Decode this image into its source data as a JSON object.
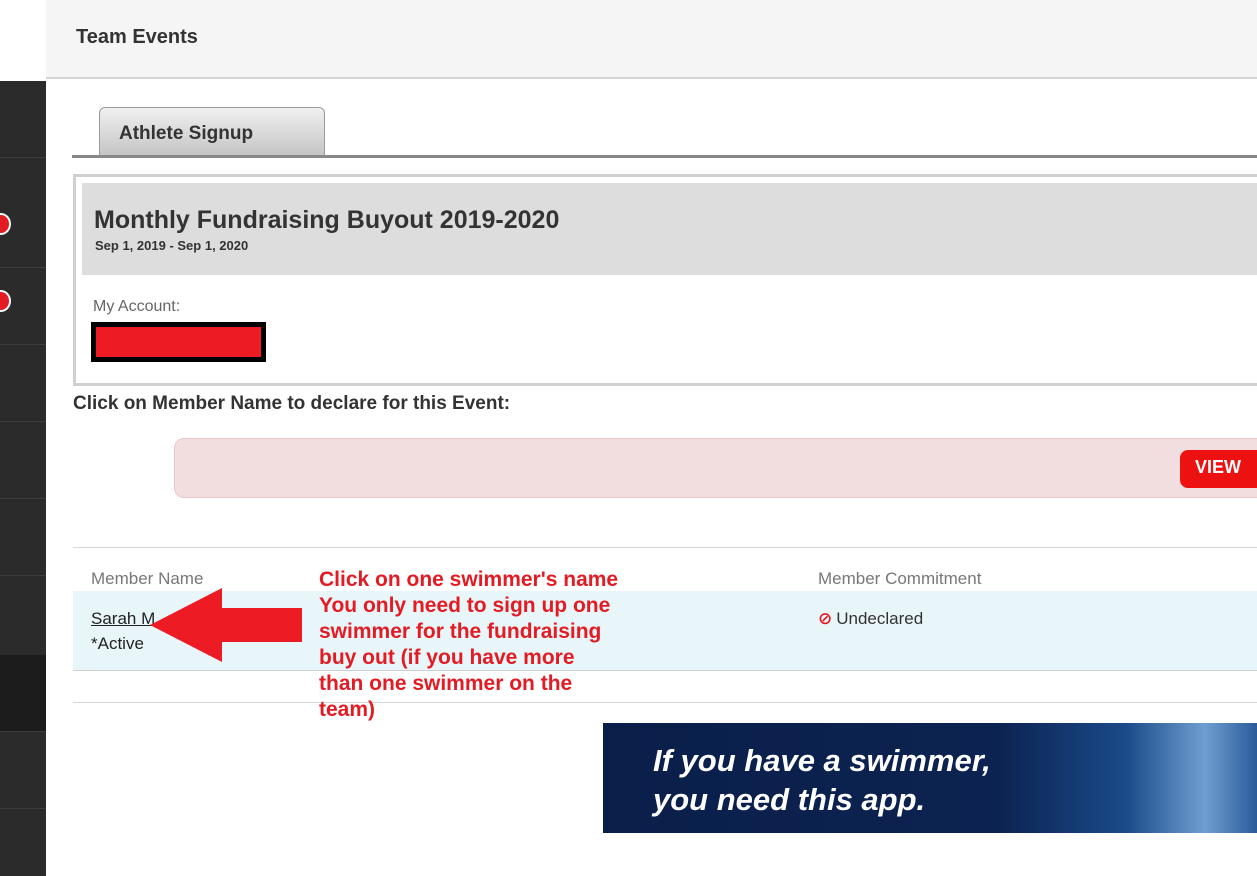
{
  "header": {
    "title": "Team Events"
  },
  "tabs": [
    {
      "label": "Athlete Signup",
      "active": true
    }
  ],
  "event": {
    "title": "Monthly Fundraising Buyout 2019-2020",
    "dates": "Sep 1, 2019 - Sep 1, 2020",
    "account_label": "My Account:"
  },
  "declare_prompt": "Click on Member Name to declare for this Event:",
  "view_button": "VIEW",
  "table": {
    "headers": [
      "Member Name",
      "Member Commitment"
    ],
    "rows": [
      {
        "name": "Sarah M",
        "status": "*Active",
        "commitment": "Undeclared"
      }
    ]
  },
  "annotation": {
    "lines": [
      "Click on one swimmer's name",
      "You only need to sign up one",
      "swimmer for the fundraising",
      "buy out (if you have more",
      "than one swimmer on the",
      "team)"
    ]
  },
  "banner": {
    "line1": "If you have a swimmer,",
    "line2": "you need this app."
  },
  "colors": {
    "accent_red": "#e31b23",
    "sidebar": "#2b2b2b",
    "alert_background": "#f2dede",
    "row_highlight": "#e9f6f9",
    "banner_navy": "#0a1f4a"
  },
  "icons": {
    "commitment_status": "ban-icon"
  }
}
